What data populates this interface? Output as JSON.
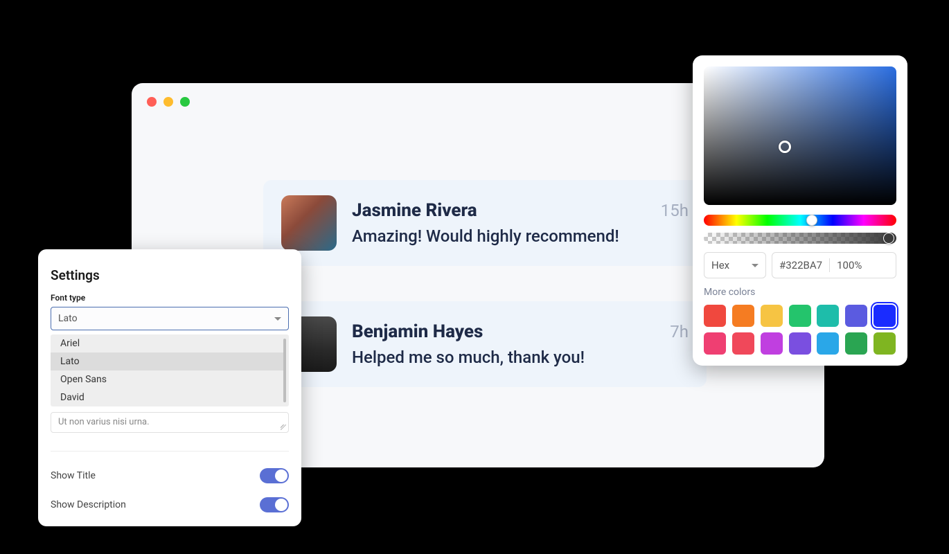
{
  "reviews": [
    {
      "name": "Jasmine Rivera",
      "time": "15h",
      "text": "Amazing! Would highly recommend!"
    },
    {
      "name": "Benjamin Hayes",
      "time": "7h",
      "text": "Helped me so much, thank you!"
    }
  ],
  "settings": {
    "title": "Settings",
    "font_label": "Font type",
    "selected_font": "Lato",
    "font_options": [
      "Ariel",
      "Lato",
      "Open Sans",
      "David"
    ],
    "placeholder_text": "Ut non varius nisi urna.",
    "show_title_label": "Show Title",
    "show_description_label": "Show Description",
    "show_title": true,
    "show_description": true
  },
  "color_picker": {
    "format": "Hex",
    "hex": "#322BA7",
    "opacity": "100%",
    "more_colors_label": "More colors",
    "swatches_row1": [
      "#f0483e",
      "#f57c22",
      "#f6c443",
      "#24c46c",
      "#1ebdaa",
      "#5b5be0",
      "#1a2cff"
    ],
    "swatches_row2": [
      "#ef3f72",
      "#f0485a",
      "#c03fe0",
      "#7a4fe0",
      "#2aa7e8",
      "#2aa552",
      "#7fb521"
    ],
    "selected_swatch_index": 6
  }
}
